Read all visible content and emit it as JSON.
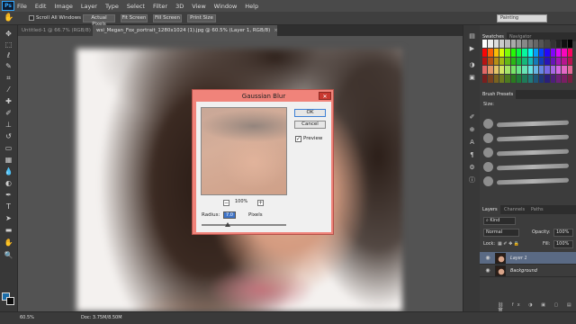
{
  "app": {
    "logo": "Ps",
    "menu": [
      "File",
      "Edit",
      "Image",
      "Layer",
      "Type",
      "Select",
      "Filter",
      "3D",
      "View",
      "Window",
      "Help"
    ]
  },
  "options_bar": {
    "scroll_all_windows": "Scroll All Windows",
    "actual_pixels": "Actual Pixels",
    "fit_screen": "Fit Screen",
    "fill_screen": "Fill Screen",
    "print_size": "Print Size",
    "workspace": "Painting"
  },
  "tabs": [
    {
      "label": "Untitled-1 @ 66.7% (RGB/8)"
    },
    {
      "label": "wsi_Megan_Fox_portrait_1280x1024 (1).jpg @ 60.5% (Layer 1, RGB/8)"
    }
  ],
  "dialog": {
    "title": "Gaussian Blur",
    "ok": "OK",
    "cancel": "Cancel",
    "preview_label": "Preview",
    "preview_checked": true,
    "zoom": "100%",
    "radius_label": "Radius:",
    "radius_value": "7.0",
    "radius_unit": "Pixels"
  },
  "panels": {
    "swatches_tab": "Swatches",
    "navigator_tab": "Navigator",
    "brush_presets_tab": "Brush Presets",
    "size_label": "Size:",
    "layers_tab": "Layers",
    "channels_tab": "Channels",
    "paths_tab": "Paths",
    "kind_label": "Kind",
    "blend_mode": "Normal",
    "opacity_label": "Opacity:",
    "opacity_value": "100%",
    "lock_label": "Lock:",
    "fill_label": "Fill:",
    "fill_value": "100%",
    "layers": [
      {
        "name": "Layer 1"
      },
      {
        "name": "Background"
      }
    ]
  },
  "status": {
    "zoom": "60.5%",
    "doc": "Doc: 3.75M/8.50M"
  },
  "colors": {
    "foreground": "#1b6da8",
    "background": "#0d0d0d",
    "dialog_frame": "#f0837a"
  },
  "tool_icons": [
    "move-icon",
    "marquee-icon",
    "lasso-icon",
    "quick-select-icon",
    "crop-icon",
    "eyedropper-icon",
    "healing-icon",
    "brush-icon",
    "clone-stamp-icon",
    "history-brush-icon",
    "eraser-icon",
    "gradient-icon",
    "blur-icon",
    "dodge-icon",
    "pen-icon",
    "type-icon",
    "path-select-icon",
    "shape-icon",
    "hand-icon",
    "zoom-icon"
  ]
}
